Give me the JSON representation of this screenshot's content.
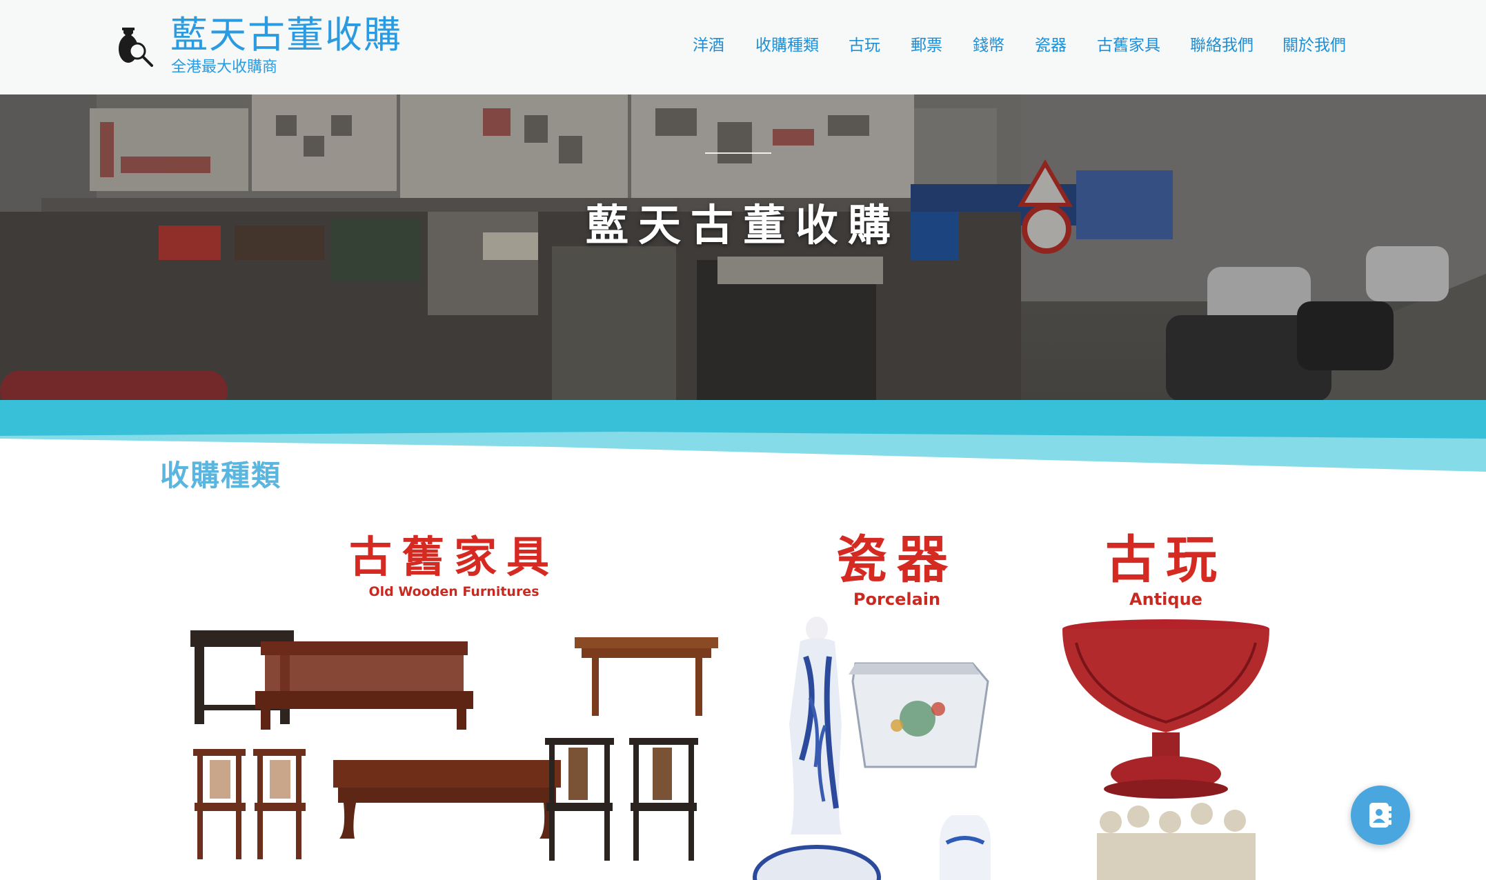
{
  "site": {
    "title": "藍天古董收購",
    "subtitle": "全港最大收購商",
    "logo_icon": "vase-magnifier-icon"
  },
  "nav": {
    "items": [
      {
        "label": "洋酒"
      },
      {
        "label": "收購種類"
      },
      {
        "label": "古玩"
      },
      {
        "label": "郵票"
      },
      {
        "label": "錢幣"
      },
      {
        "label": "瓷器"
      },
      {
        "label": "古舊家具"
      },
      {
        "label": "聯絡我們"
      },
      {
        "label": "關於我們"
      }
    ]
  },
  "hero": {
    "title": "藍天古董收購"
  },
  "section": {
    "title": "收購種類"
  },
  "cards": {
    "furniture": {
      "heading": "古舊家具",
      "subheading": "Old Wooden Furnitures"
    },
    "porcelain": {
      "heading": "瓷器",
      "subheading": "Porcelain"
    },
    "antique": {
      "heading": "古玩",
      "subheading": "Antique"
    }
  },
  "fab": {
    "icon": "contact-card-icon"
  },
  "colors": {
    "brand": "#2a9be0",
    "section_title": "#5bb6df",
    "wave_dark": "#38c0d8",
    "wave_light": "#86dbe9",
    "card_heading": "#d42a22",
    "fab": "#4aa6de"
  }
}
